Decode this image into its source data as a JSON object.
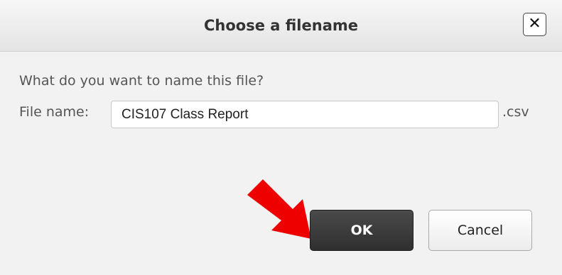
{
  "dialog": {
    "title": "Choose a filename",
    "close_glyph": "✕",
    "prompt": "What do you want to name this file?",
    "file_label": "File name:",
    "file_value": "CIS107 Class Report",
    "extension": ".csv",
    "ok_label": "OK",
    "cancel_label": "Cancel"
  },
  "annotation": {
    "arrow_icon": "red-arrow-icon",
    "arrow_color": "#ee0000"
  },
  "colors": {
    "ok_background": "#3a3a3a",
    "title_text": "#333333",
    "body_text": "#555555"
  }
}
